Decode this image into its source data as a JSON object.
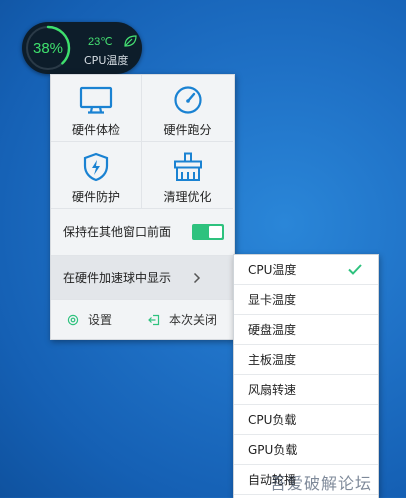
{
  "widget": {
    "percent": "38%",
    "temperature": "23℃",
    "label": "CPU温度",
    "load_fraction": 0.38,
    "accent_color": "#3ee06d",
    "leaf_icon": "leaf-icon"
  },
  "menu": {
    "tiles": [
      {
        "label": "硬件体检",
        "icon": "monitor-icon"
      },
      {
        "label": "硬件跑分",
        "icon": "speedometer-icon"
      },
      {
        "label": "硬件防护",
        "icon": "shield-lightning-icon"
      },
      {
        "label": "清理优化",
        "icon": "broom-icon"
      }
    ],
    "keep_on_top_label": "保持在其他窗口前面",
    "keep_on_top_enabled": true,
    "show_in_ball_label": "在硬件加速球中显示",
    "settings_label": "设置",
    "close_label": "本次关闭",
    "icon_color": "#1a82d2",
    "toggle_color": "#2ec27e"
  },
  "submenu": {
    "items": [
      {
        "label": "CPU温度",
        "checked": true
      },
      {
        "label": "显卡温度",
        "checked": false
      },
      {
        "label": "硬盘温度",
        "checked": false
      },
      {
        "label": "主板温度",
        "checked": false
      },
      {
        "label": "风扇转速",
        "checked": false
      },
      {
        "label": "CPU负载",
        "checked": false
      },
      {
        "label": "GPU负载",
        "checked": false
      },
      {
        "label": "自动轮播",
        "checked": false
      }
    ],
    "check_color": "#2ec27e"
  },
  "watermark": "吾爱破解论坛"
}
